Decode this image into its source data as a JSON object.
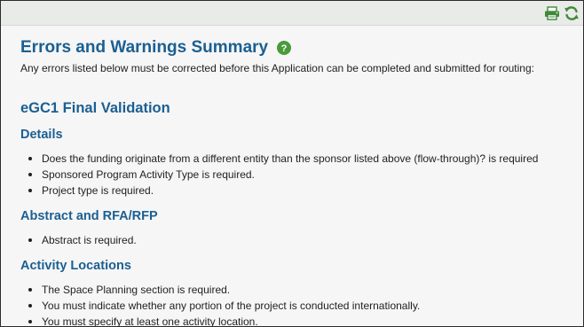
{
  "header": {
    "title": "Errors and Warnings Summary",
    "help_icon": "question-circle-icon",
    "intro": "Any errors listed below must be corrected before this Application can be completed and submitted for routing:"
  },
  "toolbar": {
    "print_icon": "printer-icon",
    "refresh_icon": "refresh-icon",
    "print_color": "#3f8a3a",
    "refresh_color": "#3f8a3a"
  },
  "validation": {
    "title": "eGC1 Final Validation",
    "sections": [
      {
        "heading": "Details",
        "items": [
          "Does the funding originate from a different entity than the sponsor listed above (flow-through)? is required",
          "Sponsored Program Activity Type is required.",
          "Project type is required."
        ]
      },
      {
        "heading": "Abstract and RFA/RFP",
        "items": [
          "Abstract is required."
        ]
      },
      {
        "heading": "Activity Locations",
        "items": [
          "The Space Planning section is required.",
          "You must indicate whether any portion of the project is conducted internationally.",
          "You must specify at least one activity location."
        ]
      }
    ]
  },
  "colors": {
    "heading": "#1b5f92",
    "background": "#f6f6f6",
    "topbar": "#e9ebe9",
    "help_icon": "#4a9a3c"
  }
}
